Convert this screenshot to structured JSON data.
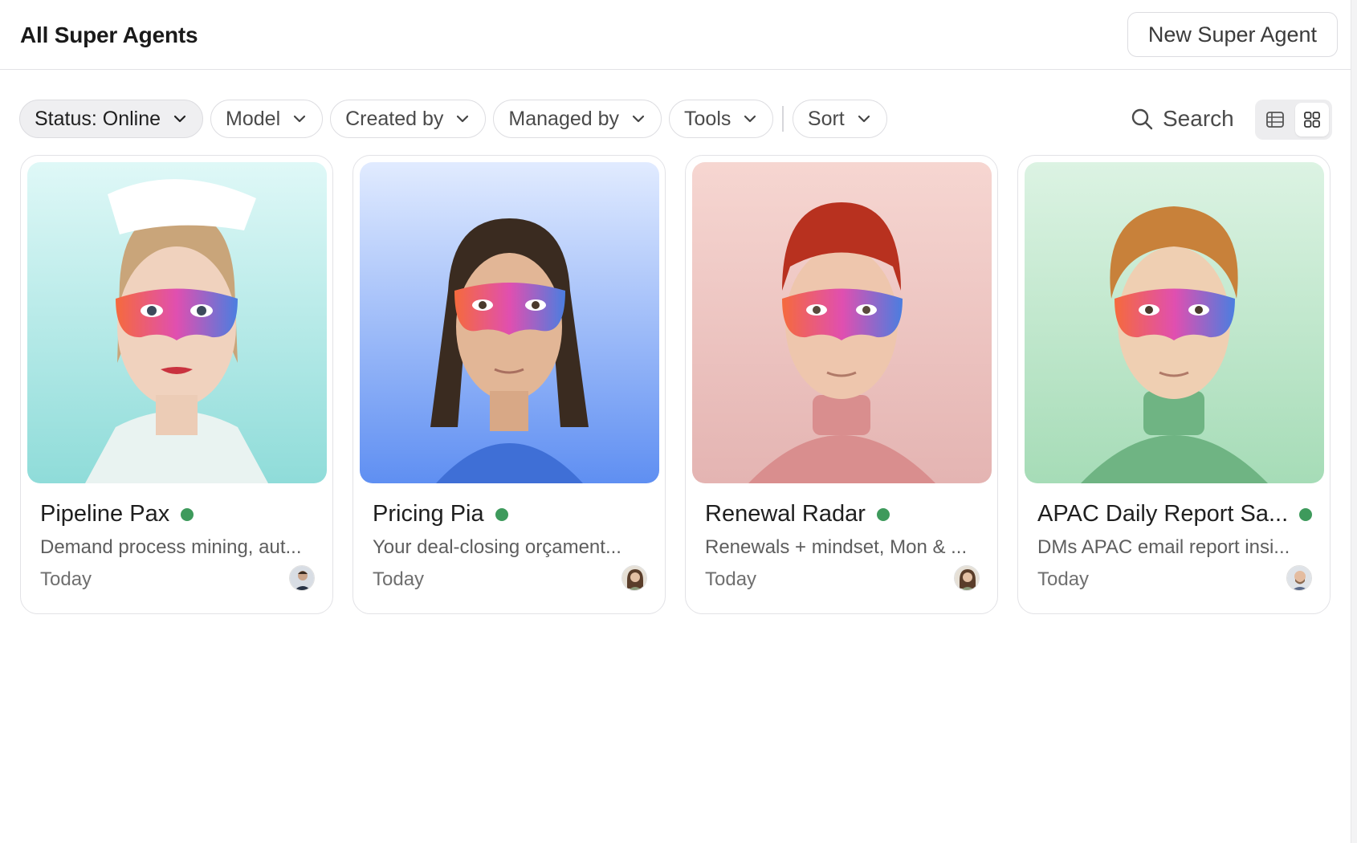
{
  "header": {
    "title": "All Super Agents",
    "new_button_label": "New Super Agent"
  },
  "filters": {
    "status": {
      "label": "Status: Online",
      "icon": "chevron-down-icon"
    },
    "model": {
      "label": "Model",
      "icon": "chevron-down-icon"
    },
    "created_by": {
      "label": "Created by",
      "icon": "chevron-down-icon"
    },
    "managed_by": {
      "label": "Managed by",
      "icon": "chevron-down-icon"
    },
    "tools": {
      "label": "Tools",
      "icon": "chevron-down-icon"
    },
    "sort": {
      "label": "Sort",
      "icon": "chevron-down-icon"
    }
  },
  "search": {
    "label": "Search",
    "icon": "search-icon"
  },
  "view_toggle": {
    "options": [
      "table-view",
      "grid-view"
    ],
    "selected": "grid-view"
  },
  "agents": [
    {
      "name": "Pipeline Pax",
      "status": "online",
      "description": "Demand process mining, aut...",
      "date": "Today",
      "background": "#9fe3e0",
      "avatar": "man-dark-suit"
    },
    {
      "name": "Pricing Pia",
      "status": "online",
      "description": "Your deal-closing orçament...",
      "date": "Today",
      "background": "#7aa2f5",
      "avatar": "woman-curly-hair"
    },
    {
      "name": "Renewal Radar",
      "status": "online",
      "description": "Renewals + mindset, Mon & ...",
      "date": "Today",
      "background": "#eab9b6",
      "avatar": "woman-curly-hair"
    },
    {
      "name": "APAC Daily Report Sa...",
      "status": "online",
      "description": "DMs APAC email report insi...",
      "date": "Today",
      "background": "#b3e2c1",
      "avatar": "man-bald-beard"
    }
  ],
  "colors": {
    "status_online": "#3e9a5c",
    "border": "#e2e2e6",
    "active_chip_bg": "#efeff1"
  }
}
